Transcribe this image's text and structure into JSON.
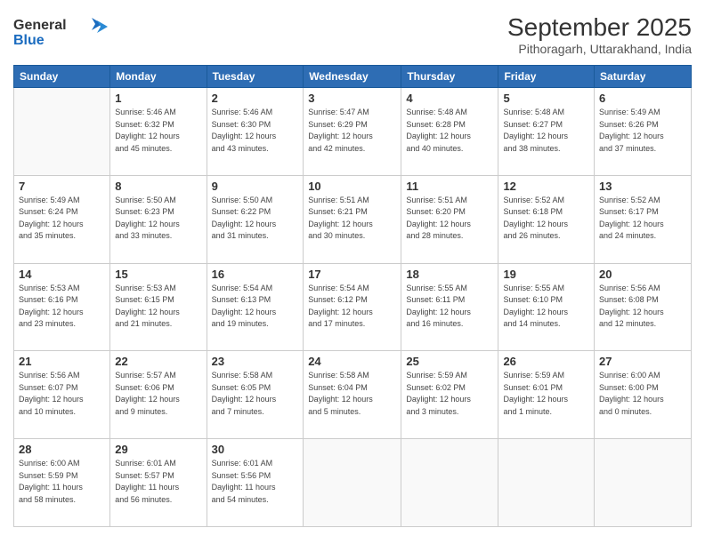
{
  "header": {
    "logo_line1": "General",
    "logo_line2": "Blue",
    "month": "September 2025",
    "location": "Pithoragarh, Uttarakhand, India"
  },
  "weekdays": [
    "Sunday",
    "Monday",
    "Tuesday",
    "Wednesday",
    "Thursday",
    "Friday",
    "Saturday"
  ],
  "weeks": [
    [
      {
        "day": "",
        "info": ""
      },
      {
        "day": "1",
        "info": "Sunrise: 5:46 AM\nSunset: 6:32 PM\nDaylight: 12 hours\nand 45 minutes."
      },
      {
        "day": "2",
        "info": "Sunrise: 5:46 AM\nSunset: 6:30 PM\nDaylight: 12 hours\nand 43 minutes."
      },
      {
        "day": "3",
        "info": "Sunrise: 5:47 AM\nSunset: 6:29 PM\nDaylight: 12 hours\nand 42 minutes."
      },
      {
        "day": "4",
        "info": "Sunrise: 5:48 AM\nSunset: 6:28 PM\nDaylight: 12 hours\nand 40 minutes."
      },
      {
        "day": "5",
        "info": "Sunrise: 5:48 AM\nSunset: 6:27 PM\nDaylight: 12 hours\nand 38 minutes."
      },
      {
        "day": "6",
        "info": "Sunrise: 5:49 AM\nSunset: 6:26 PM\nDaylight: 12 hours\nand 37 minutes."
      }
    ],
    [
      {
        "day": "7",
        "info": "Sunrise: 5:49 AM\nSunset: 6:24 PM\nDaylight: 12 hours\nand 35 minutes."
      },
      {
        "day": "8",
        "info": "Sunrise: 5:50 AM\nSunset: 6:23 PM\nDaylight: 12 hours\nand 33 minutes."
      },
      {
        "day": "9",
        "info": "Sunrise: 5:50 AM\nSunset: 6:22 PM\nDaylight: 12 hours\nand 31 minutes."
      },
      {
        "day": "10",
        "info": "Sunrise: 5:51 AM\nSunset: 6:21 PM\nDaylight: 12 hours\nand 30 minutes."
      },
      {
        "day": "11",
        "info": "Sunrise: 5:51 AM\nSunset: 6:20 PM\nDaylight: 12 hours\nand 28 minutes."
      },
      {
        "day": "12",
        "info": "Sunrise: 5:52 AM\nSunset: 6:18 PM\nDaylight: 12 hours\nand 26 minutes."
      },
      {
        "day": "13",
        "info": "Sunrise: 5:52 AM\nSunset: 6:17 PM\nDaylight: 12 hours\nand 24 minutes."
      }
    ],
    [
      {
        "day": "14",
        "info": "Sunrise: 5:53 AM\nSunset: 6:16 PM\nDaylight: 12 hours\nand 23 minutes."
      },
      {
        "day": "15",
        "info": "Sunrise: 5:53 AM\nSunset: 6:15 PM\nDaylight: 12 hours\nand 21 minutes."
      },
      {
        "day": "16",
        "info": "Sunrise: 5:54 AM\nSunset: 6:13 PM\nDaylight: 12 hours\nand 19 minutes."
      },
      {
        "day": "17",
        "info": "Sunrise: 5:54 AM\nSunset: 6:12 PM\nDaylight: 12 hours\nand 17 minutes."
      },
      {
        "day": "18",
        "info": "Sunrise: 5:55 AM\nSunset: 6:11 PM\nDaylight: 12 hours\nand 16 minutes."
      },
      {
        "day": "19",
        "info": "Sunrise: 5:55 AM\nSunset: 6:10 PM\nDaylight: 12 hours\nand 14 minutes."
      },
      {
        "day": "20",
        "info": "Sunrise: 5:56 AM\nSunset: 6:08 PM\nDaylight: 12 hours\nand 12 minutes."
      }
    ],
    [
      {
        "day": "21",
        "info": "Sunrise: 5:56 AM\nSunset: 6:07 PM\nDaylight: 12 hours\nand 10 minutes."
      },
      {
        "day": "22",
        "info": "Sunrise: 5:57 AM\nSunset: 6:06 PM\nDaylight: 12 hours\nand 9 minutes."
      },
      {
        "day": "23",
        "info": "Sunrise: 5:58 AM\nSunset: 6:05 PM\nDaylight: 12 hours\nand 7 minutes."
      },
      {
        "day": "24",
        "info": "Sunrise: 5:58 AM\nSunset: 6:04 PM\nDaylight: 12 hours\nand 5 minutes."
      },
      {
        "day": "25",
        "info": "Sunrise: 5:59 AM\nSunset: 6:02 PM\nDaylight: 12 hours\nand 3 minutes."
      },
      {
        "day": "26",
        "info": "Sunrise: 5:59 AM\nSunset: 6:01 PM\nDaylight: 12 hours\nand 1 minute."
      },
      {
        "day": "27",
        "info": "Sunrise: 6:00 AM\nSunset: 6:00 PM\nDaylight: 12 hours\nand 0 minutes."
      }
    ],
    [
      {
        "day": "28",
        "info": "Sunrise: 6:00 AM\nSunset: 5:59 PM\nDaylight: 11 hours\nand 58 minutes."
      },
      {
        "day": "29",
        "info": "Sunrise: 6:01 AM\nSunset: 5:57 PM\nDaylight: 11 hours\nand 56 minutes."
      },
      {
        "day": "30",
        "info": "Sunrise: 6:01 AM\nSunset: 5:56 PM\nDaylight: 11 hours\nand 54 minutes."
      },
      {
        "day": "",
        "info": ""
      },
      {
        "day": "",
        "info": ""
      },
      {
        "day": "",
        "info": ""
      },
      {
        "day": "",
        "info": ""
      }
    ]
  ]
}
